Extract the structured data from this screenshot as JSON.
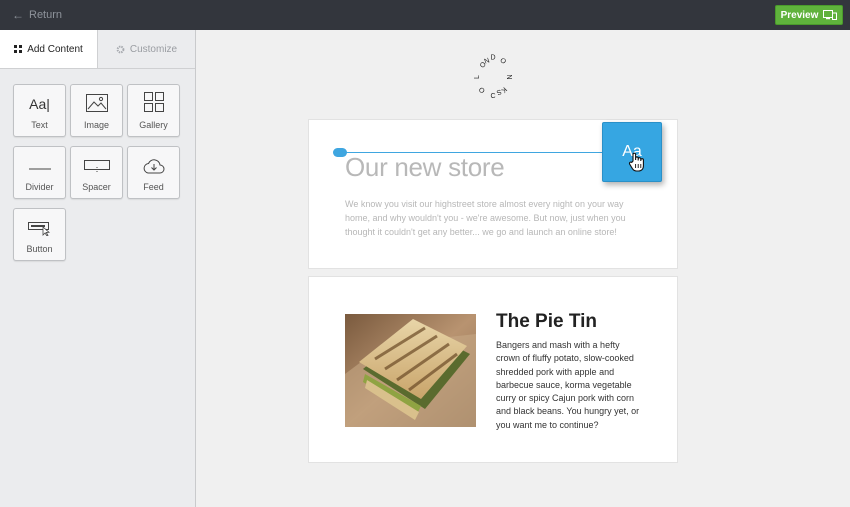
{
  "topbar": {
    "return_label": "Return",
    "preview_label": "Preview",
    "colors": {
      "bar": "#33363d",
      "preview": "#5fb23c"
    }
  },
  "sidebar": {
    "tabs": [
      {
        "label": "Add Content",
        "icon": "grid-icon",
        "active": true
      },
      {
        "label": "Customize",
        "icon": "gear-icon",
        "active": false
      }
    ],
    "tiles": [
      {
        "label": "Text",
        "icon": "text-icon"
      },
      {
        "label": "Image",
        "icon": "image-icon"
      },
      {
        "label": "Gallery",
        "icon": "gallery-icon"
      },
      {
        "label": "Divider",
        "icon": "divider-icon"
      },
      {
        "label": "Spacer",
        "icon": "spacer-icon"
      },
      {
        "label": "Feed",
        "icon": "cloud-download-icon"
      },
      {
        "label": "Button",
        "icon": "button-cursor-icon"
      }
    ]
  },
  "canvas": {
    "logo_text": "LONDON DOCKS",
    "block1": {
      "headline": "Our new store",
      "intro": "We know you visit our highstreet store almost every night on your way home, and why wouldn't you - we're awesome. But now, just when you thought it couldn't get any better... we go and launch an online store!"
    },
    "drag_tile": {
      "glyph": "Aa",
      "icon": "hand-cursor-icon",
      "color": "#36a6e2"
    },
    "block2": {
      "title": "The Pie Tin",
      "description": "Bangers and mash with a hefty crown of fluffy potato, slow-cooked shredded pork with apple and barbecue sauce, korma vegetable curry or spicy Cajun pork with corn and black beans. You hungry yet, or you want me to continue?",
      "image": "sandwich-photo"
    }
  }
}
